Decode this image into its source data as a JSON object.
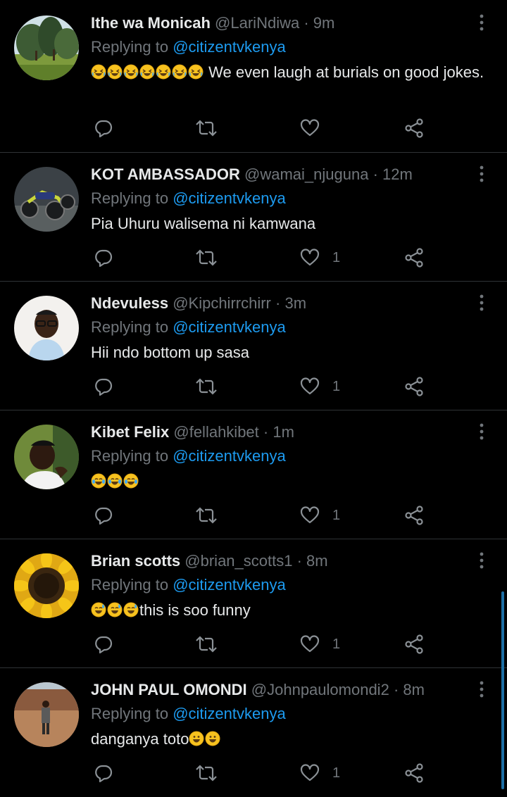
{
  "accent_color": "#1d9bf0",
  "replying_label": "Replying to",
  "tweets": [
    {
      "name": "Ithe wa Monicah",
      "handle": "@LariNdiwa",
      "time": "9m",
      "mention": "@citizentvkenya",
      "emoji": "rofl",
      "emoji_count": 7,
      "text": " We even laugh at burials on good jokes.",
      "like_count": "",
      "avatar": "landscape-trees"
    },
    {
      "name": "KOT AMBASSADOR",
      "handle": "@wamai_njuguna",
      "time": "12m",
      "mention": "@citizentvkenya",
      "emoji": "",
      "emoji_count": 0,
      "text": "Pia Uhuru walisema ni kamwana",
      "like_count": "1",
      "avatar": "motorcycles"
    },
    {
      "name": "Ndevuless",
      "handle": "@Kipchirrchirr",
      "time": "3m",
      "mention": "@citizentvkenya",
      "emoji": "",
      "emoji_count": 0,
      "text": "Hii ndo bottom up sasa",
      "like_count": "1",
      "avatar": "person-glasses"
    },
    {
      "name": "Kibet Felix",
      "handle": "@fellahkibet",
      "time": "1m",
      "mention": "@citizentvkenya",
      "emoji": "joy",
      "emoji_count": 3,
      "text": "",
      "like_count": "1",
      "avatar": "selfie-person"
    },
    {
      "name": "Brian scotts",
      "handle": "@brian_scotts1",
      "time": "8m",
      "mention": "@citizentvkenya",
      "emoji": "sweat-smile",
      "emoji_count": 3,
      "text": "this is soo funny",
      "like_count": "1",
      "avatar": "sunflower"
    },
    {
      "name": "JOHN PAUL OMONDI",
      "handle": "@Johnpaulomondi2",
      "time": "8m",
      "mention": "@citizentvkenya",
      "emoji_after": "grinning",
      "emoji_after_count": 2,
      "text": "danganya toto",
      "like_count": "1",
      "avatar": "person-field"
    }
  ]
}
